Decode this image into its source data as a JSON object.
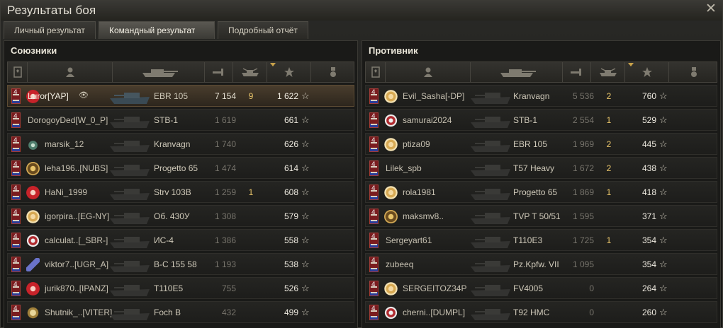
{
  "window": {
    "title": "Результаты боя",
    "close_icon": "close-icon"
  },
  "tabs": [
    {
      "label": "Личный результат",
      "active": false
    },
    {
      "label": "Командный результат",
      "active": true
    },
    {
      "label": "Подробный отчёт",
      "active": false
    }
  ],
  "allies": {
    "title": "Союзники",
    "rows": [
      {
        "player": "Luror[YAP]",
        "badge": "red",
        "vehicle": "EBR 105",
        "damage": "7 154",
        "kills": "9",
        "xp": "1 622",
        "highlight": true,
        "bright_damage": true
      },
      {
        "player": "DorogoyDed[W_0_P]",
        "badge": "",
        "vehicle": "STB-1",
        "damage": "1 619",
        "kills": "",
        "xp": "661"
      },
      {
        "player": "marsik_12",
        "badge": "star",
        "vehicle": "Kranvagn",
        "damage": "1 740",
        "kills": "",
        "xp": "626"
      },
      {
        "player": "leha196..[NUBS]",
        "badge": "gold",
        "vehicle": "Progetto 65",
        "damage": "1 474",
        "kills": "",
        "xp": "614"
      },
      {
        "player": "HaNi_1999",
        "badge": "red",
        "vehicle": "Strv 103B",
        "damage": "1 259",
        "kills": "1",
        "xp": "608"
      },
      {
        "player": "igorpira..[EG-NY]",
        "badge": "flower",
        "vehicle": "Об. 430У",
        "damage": "1 308",
        "kills": "",
        "xp": "579"
      },
      {
        "player": "calculat..[_SBR-]",
        "badge": "diamond",
        "vehicle": "ИС-4",
        "damage": "1 386",
        "kills": "",
        "xp": "558"
      },
      {
        "player": "viktor7..[UGR_A]",
        "badge": "blue",
        "vehicle": "B-C 155 58",
        "damage": "1 193",
        "kills": "",
        "xp": "538"
      },
      {
        "player": "jurik870..[IPANZ]",
        "badge": "red",
        "vehicle": "T110E5",
        "damage": "755",
        "kills": "",
        "xp": "526"
      },
      {
        "player": "Shutnik_..[VITER]",
        "badge": "shield",
        "vehicle": "Foch B",
        "damage": "432",
        "kills": "",
        "xp": "499"
      }
    ]
  },
  "enemies": {
    "title": "Противник",
    "rows": [
      {
        "player": "Evil_Sasha[-DP]",
        "badge": "flower",
        "vehicle": "Kranvagn",
        "damage": "5 536",
        "kills": "2",
        "xp": "760"
      },
      {
        "player": "samurai2024",
        "badge": "diamond",
        "vehicle": "STB-1",
        "damage": "2 554",
        "kills": "1",
        "xp": "529"
      },
      {
        "player": "ptiza09",
        "badge": "flower",
        "vehicle": "EBR 105",
        "damage": "1 969",
        "kills": "2",
        "xp": "445"
      },
      {
        "player": "Lilek_spb",
        "badge": "",
        "vehicle": "T57 Heavy",
        "damage": "1 672",
        "kills": "2",
        "xp": "438"
      },
      {
        "player": "rola1981",
        "badge": "flower",
        "vehicle": "Progetto 65",
        "damage": "1 869",
        "kills": "1",
        "xp": "418"
      },
      {
        "player": "maksmv8..",
        "badge": "gold",
        "vehicle": "TVP T 50/51",
        "damage": "1 595",
        "kills": "",
        "xp": "371"
      },
      {
        "player": "Sergeyart61",
        "badge": "",
        "vehicle": "T110E3",
        "damage": "1 725",
        "kills": "1",
        "xp": "354"
      },
      {
        "player": "zubeeq",
        "badge": "",
        "vehicle": "Pz.Kpfw. VII",
        "damage": "1 095",
        "kills": "",
        "xp": "354"
      },
      {
        "player": "SERGEITOZ34P",
        "badge": "flower",
        "vehicle": "FV4005",
        "damage": "0",
        "kills": "",
        "xp": "264"
      },
      {
        "player": "cherni..[DUMPL]",
        "badge": "diamond",
        "vehicle": "T92 HMC",
        "damage": "0",
        "kills": "",
        "xp": "260"
      }
    ]
  },
  "colors": {
    "accent": "#e9c56a",
    "rank_red": "#7a1c1f"
  }
}
